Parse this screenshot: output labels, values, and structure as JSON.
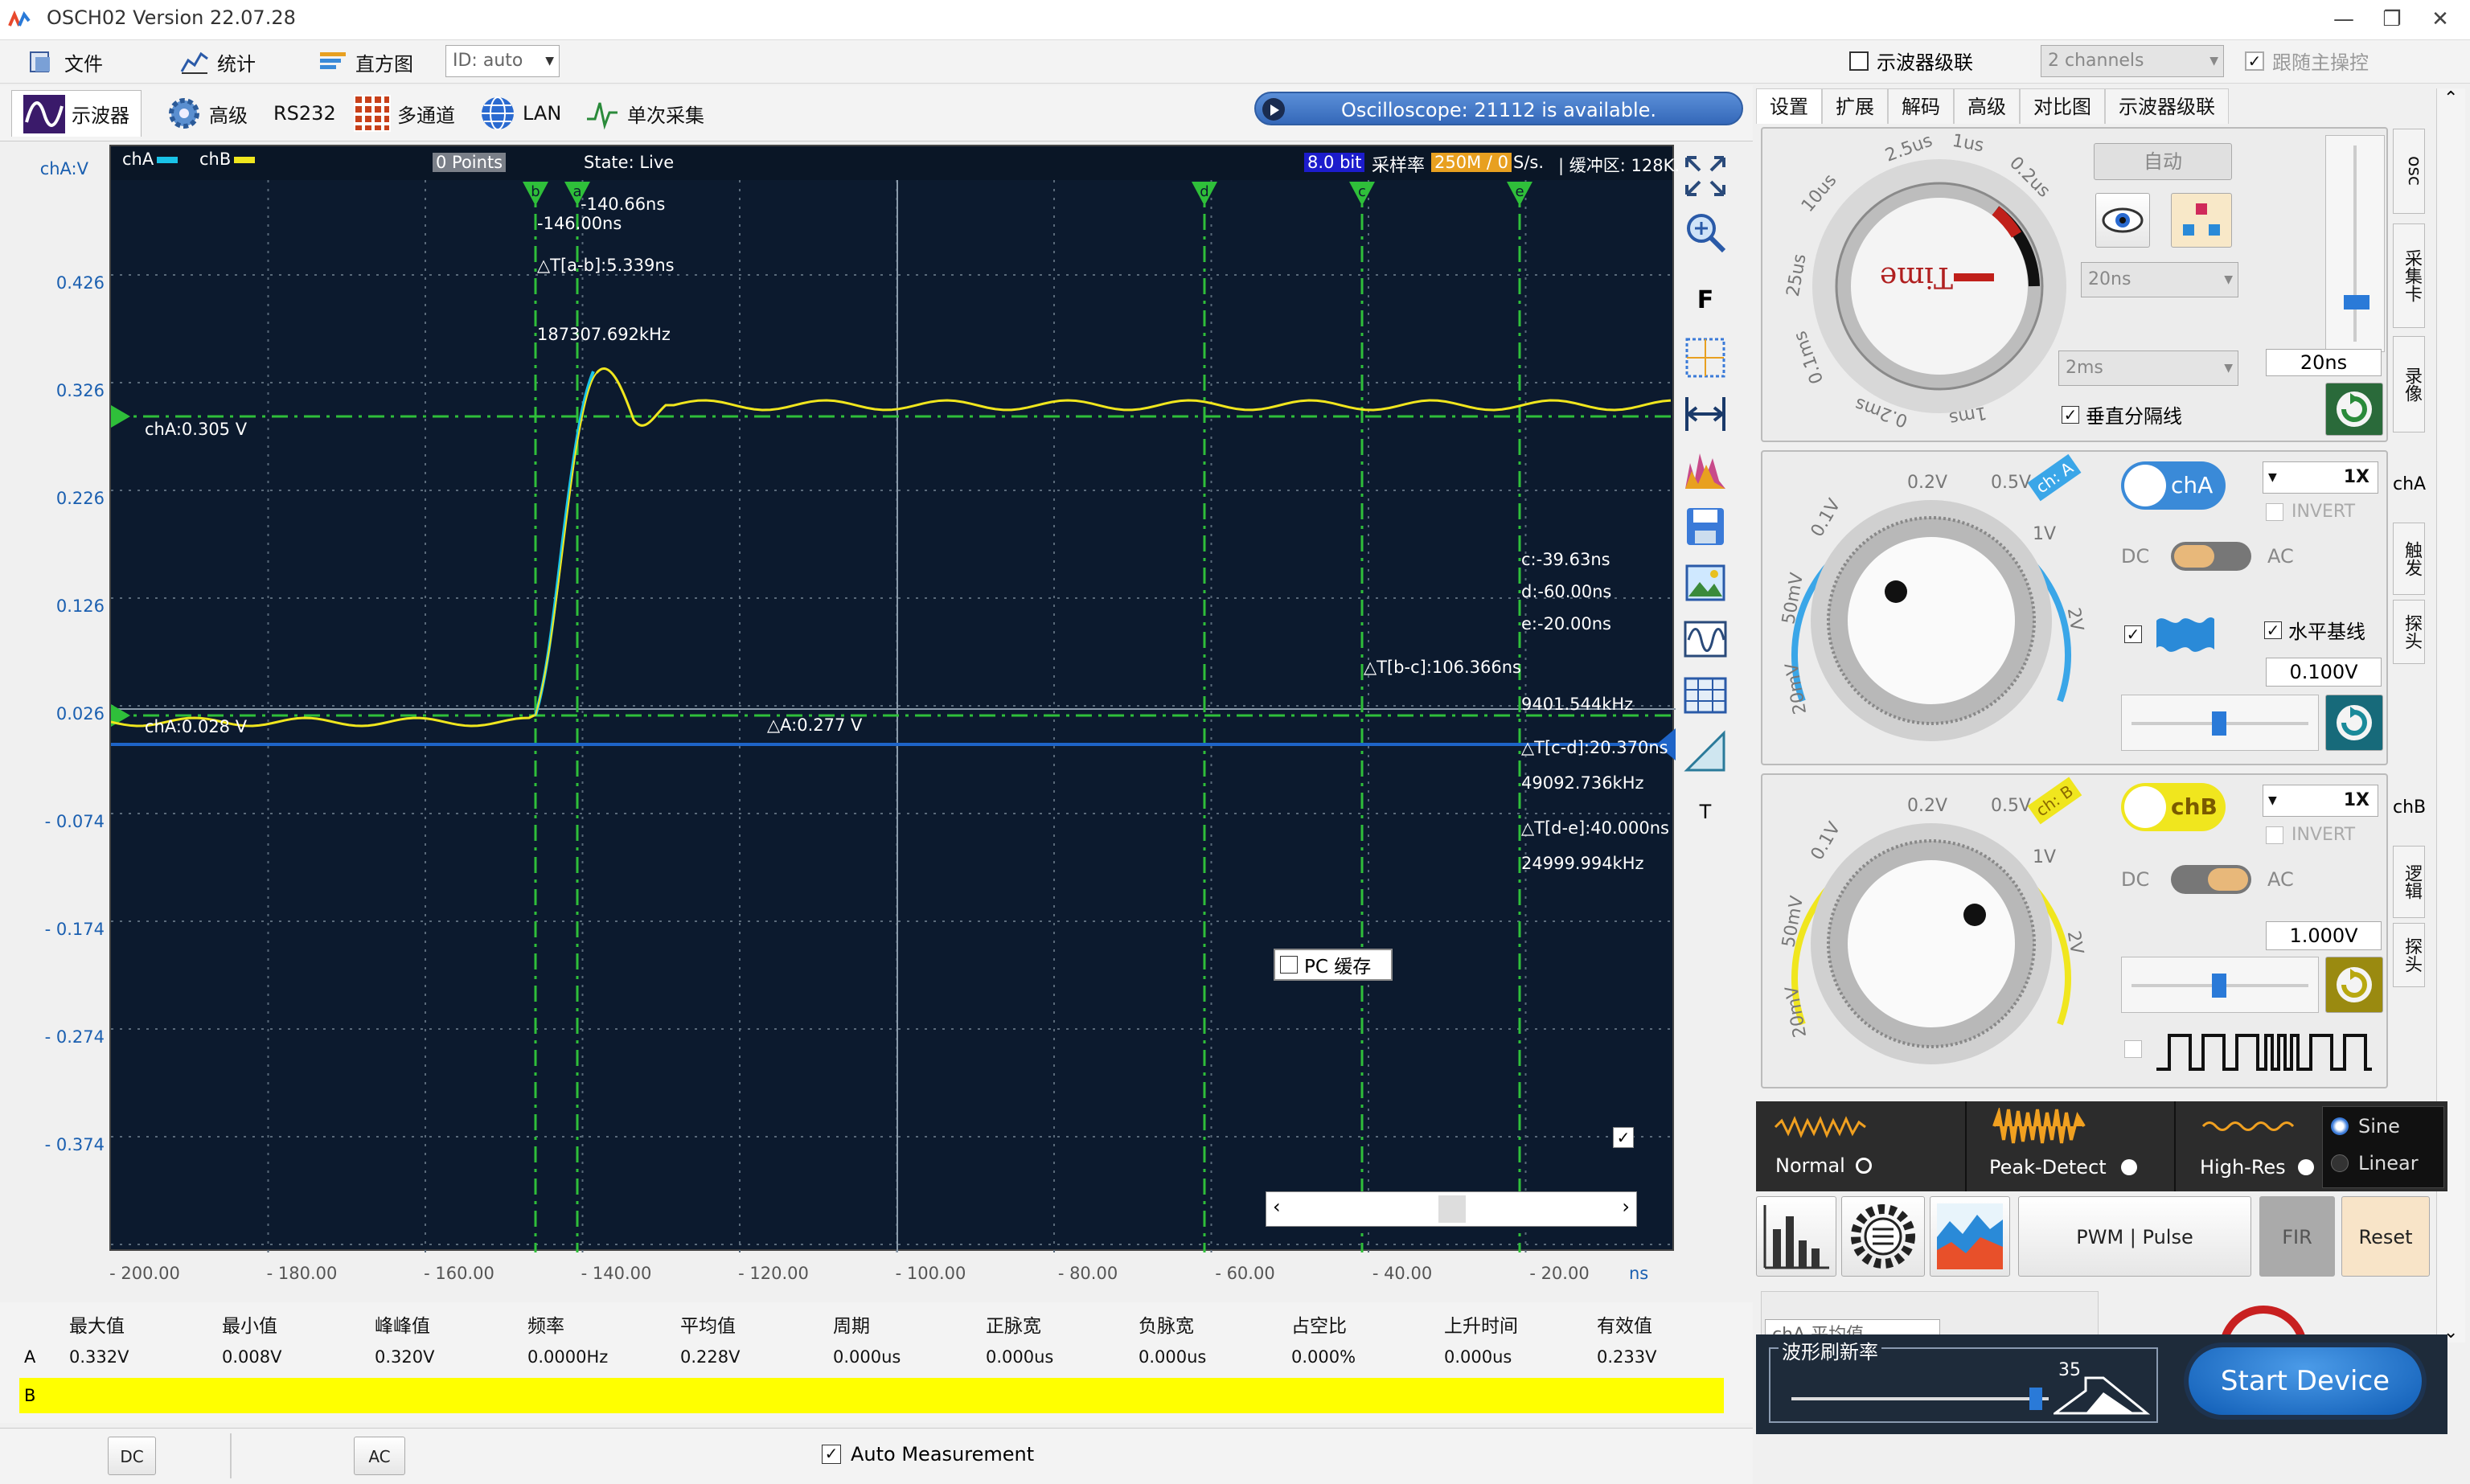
{
  "window": {
    "title": "OSCH02  Version 22.07.28",
    "controls": [
      "—",
      "❐",
      "✕"
    ]
  },
  "menu": {
    "file": "文件",
    "stats": "统计",
    "histogram": "直方图",
    "id_select": "ID: auto",
    "cascade_label": "示波器级联",
    "channels_select": "2 channels",
    "follow_label": "跟随主操控"
  },
  "toolbar": {
    "oscilloscope": "示波器",
    "advanced": "高级",
    "rs232": "RS232",
    "multichannel": "多通道",
    "lan": "LAN",
    "single": "单次采集",
    "banner": "Oscilloscope: 21112 is available."
  },
  "plot": {
    "y_unit": "chA:V",
    "legend_a": "chA",
    "legend_b": "chB",
    "points": "0 Points",
    "state": "State: Live",
    "bits": "8.0 bit",
    "rate_label": "采样率",
    "rate_value": "250M / 0",
    "rate_unit": "S/s.",
    "buffer": "| 缓冲区: 128K.",
    "y_ticks": [
      "0.426",
      "0.326",
      "0.226",
      "0.126",
      "0.026",
      "- 0.074",
      "- 0.174",
      "- 0.274",
      "- 0.374"
    ],
    "x_ticks": [
      "- 200.00",
      "- 180.00",
      "- 160.00",
      "- 140.00",
      "- 120.00",
      "- 100.00",
      "- 80.00",
      "- 60.00",
      "- 40.00",
      "- 20.00"
    ],
    "x_unit": "ns",
    "markers": [
      "b",
      "a",
      "d",
      "c",
      "e"
    ],
    "cursor_a_time": "-140.66ns",
    "cursor_b_time": "-146.00ns",
    "delta_ab": "△T[a-b]:5.339ns",
    "freq_ab": "187307.692kHz",
    "level_upper": "chA:0.305 V",
    "level_lower": "chA:0.028 V",
    "delta_a": "△A:0.277 V",
    "cursor_c": "c:-39.63ns",
    "cursor_d": "d:-60.00ns",
    "cursor_e": "e:-20.00ns",
    "delta_bc": "△T[b-c]:106.366ns",
    "freq_bc": "9401.544kHz",
    "delta_cd": "△T[c-d]:20.370ns",
    "freq_cd": "49092.736kHz",
    "delta_de": "△T[d-e]:40.000ns",
    "freq_de": "24999.994kHz",
    "pc_cache": "PC 缓存",
    "side_f": "F",
    "side_t": "T"
  },
  "right": {
    "tabs": [
      "设置",
      "扩展",
      "解码",
      "高级",
      "对比图",
      "示波器级联"
    ],
    "auto": "自动",
    "time_select1": "20ns",
    "time_select2": "2ms",
    "time_value": "20ns",
    "vertical_grid": "垂直分隔线",
    "time_knob_labels": [
      "2.5us",
      "1us",
      "0.2us",
      "10us",
      "25us",
      "0.1ms",
      "0.2ms",
      "1ms"
    ],
    "time_knob_text": "Time",
    "vtabs_top": [
      "osc",
      "采集卡",
      "录像"
    ],
    "cha": {
      "button": "chA",
      "probe": "1X",
      "invert": "INVERT",
      "dc": "DC",
      "ac": "AC",
      "baseline": "水平基线",
      "value": "0.100V",
      "tag": "ch: A",
      "knob_labels": [
        "0.2V",
        "0.5V",
        "1V",
        "0.1V",
        "2V",
        "50mV",
        "20mV"
      ],
      "vtabs": [
        "chA",
        "触发",
        "探头"
      ]
    },
    "chb": {
      "button": "chB",
      "probe": "1X",
      "invert": "INVERT",
      "dc": "DC",
      "ac": "AC",
      "value": "1.000V",
      "tag": "ch: B",
      "knob_labels": [
        "0.2V",
        "0.5V",
        "1V",
        "0.1V",
        "2V",
        "50mV",
        "20mV"
      ],
      "vtabs": [
        "chB",
        "逻辑",
        "探头"
      ]
    },
    "modes": {
      "normal": "Normal",
      "peak": "Peak-Detect",
      "highres": "High-Res",
      "sine": "Sine",
      "linear": "Linear"
    },
    "buttons": {
      "pwm": "PWM | Pulse",
      "fir": "FIR",
      "reset": "Reset"
    },
    "avg_select": "chA 平均值",
    "refresh_label": "波形刷新率",
    "refresh_value": "35",
    "start": "Start Device"
  },
  "measurements": {
    "headers": [
      "最大值",
      "最小值",
      "峰峰值",
      "频率",
      "平均值",
      "周期",
      "正脉宽",
      "负脉宽",
      "占空比",
      "上升时间",
      "有效值"
    ],
    "row_a_label": "A",
    "row_a": [
      "0.332V",
      "0.008V",
      "0.320V",
      "0.0000Hz",
      "0.228V",
      "0.000us",
      "0.000us",
      "0.000us",
      "0.000%",
      "0.000us",
      "0.233V"
    ],
    "row_b_label": "B"
  },
  "bottom": {
    "dc": "DC",
    "ac": "AC",
    "auto_measurement": "Auto Measurement"
  },
  "colors": {
    "cha": "#19c3e8",
    "chb": "#f0e61e",
    "plot_bg": "#0c1a2e",
    "grid": "#4a5a6a",
    "cursor": "#2fbf3a",
    "accent": "#1e64c8"
  }
}
